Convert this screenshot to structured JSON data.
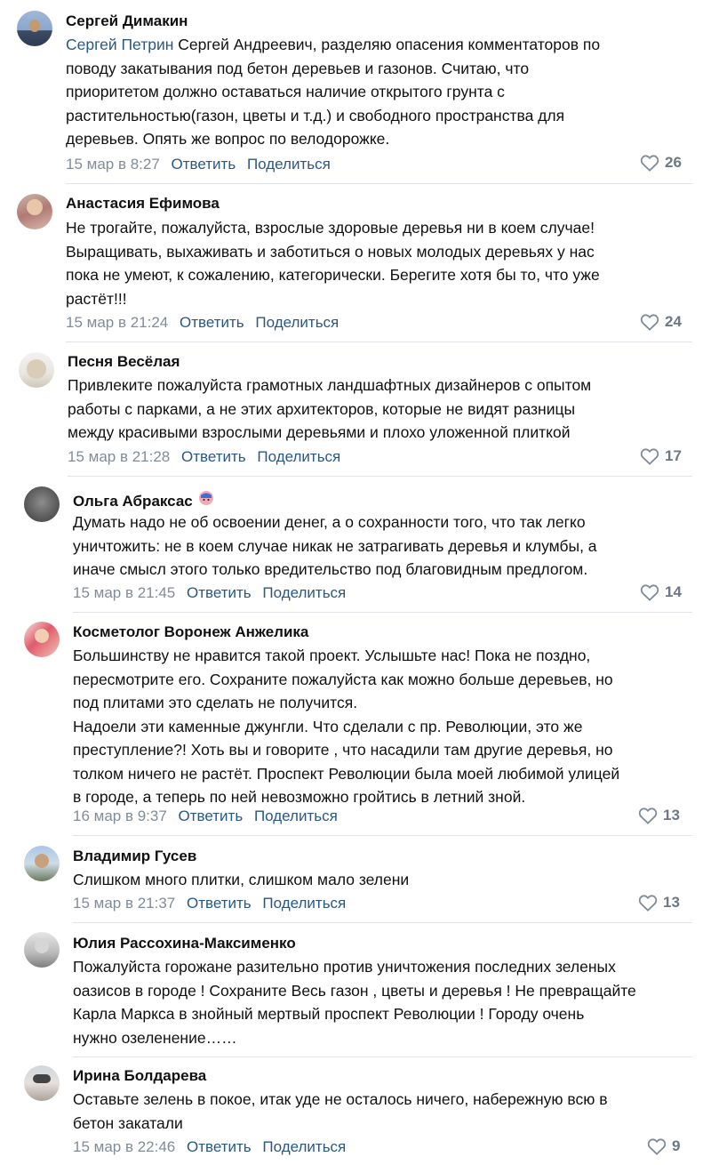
{
  "comments": [
    {
      "author": "Сергей Димакин",
      "mention": "Сергей Петрин",
      "lines": [
        " Сергей Андреевич, разделяю опасения комментаторов по",
        "поводу закатывания под бетон деревьев и газонов. Считаю, что",
        "приоритетом должно оставаться наличие открытого грунта с",
        "растительностью(газон, цветы и т.д.) и свободного пространства для",
        "деревьев. Опять же вопрос по велодорожке."
      ],
      "time": "15 мар в 8:27",
      "reply": "Ответить",
      "share": "Поделиться",
      "likes": "26"
    },
    {
      "author": "Анастасия Ефимова",
      "lines": [
        "Не трогайте, пожалуйста, взрослые здоровые деревья ни в коем случае!",
        "Выращивать, выхаживать и заботиться о новых молодых деревьях у нас",
        "пока не умеют, к сожалению, категорически. Берегите хотя бы то, что уже",
        "растёт!!!"
      ],
      "time": "15 мар в 21:24",
      "reply": "Ответить",
      "share": "Поделиться",
      "likes": "24"
    },
    {
      "author": "Песня Весёлая",
      "lines": [
        "Привлеките пожалуйста грамотных ландшафтных дизайнеров с опытом",
        "работы с парками, а не этих архитекторов, которые не видят разницы",
        "между красивыми взрослыми деревьями и плохо уложенной плиткой"
      ],
      "time": "15 мар в 21:28",
      "reply": "Ответить",
      "share": "Поделиться",
      "likes": "17"
    },
    {
      "author": "Ольга Абраксас",
      "lines": [
        "Думать надо не об освоении денег, а о сохранности того, что так легко",
        "уничтожить: не в коем случае никак не затрагивать деревья и клумбы, а",
        "иначе смысл этого только вредительство под благовидным предлогом."
      ],
      "time": "15 мар в 21:45",
      "reply": "Ответить",
      "share": "Поделиться",
      "likes": "14"
    },
    {
      "author": "Косметолог Воронеж Анжелика",
      "lines": [
        "Большинству не нравится такой проект. Услышьте нас! Пока не поздно,",
        "пересмотрите его. Сохраните пожалуйста как можно больше деревьев, но",
        "под плитами это сделать не получится.",
        "Надоели эти каменные джунгли. Что сделали с пр. Революции, это же",
        "преступление?! Хоть вы и говорите , что насадили там другие деревья, но",
        "толком ничего не растёт. Проспект Революции была моей любимой улицей",
        "в городе, а теперь по ней невозможно гройтись в летний зной."
      ],
      "time": "16 мар в 9:37",
      "reply": "Ответить",
      "share": "Поделиться",
      "likes": "13"
    },
    {
      "author": "Владимир Гусев",
      "lines": [
        "Слишком много плитки, слишком мало зелени"
      ],
      "time": "15 мар в 21:37",
      "reply": "Ответить",
      "share": "Поделиться",
      "likes": "13"
    },
    {
      "author": "Юлия Рассохина-Максименко",
      "lines": [
        "Пожалуйста горожане разительно против уничтожения последних зеленых",
        "оазисов в городе ! Сохраните Весь газон , цветы и деревья ! Не превращайте",
        "Карла Маркса в знойный мертвый проспект Революции ! Городу очень",
        "нужно озеленение……"
      ]
    },
    {
      "author": "Ирина Болдарева",
      "lines": [
        "Оставьте зелень в покое, итак уде не осталось ничего, набережную всю в",
        "бетон закатали"
      ],
      "time": "15 мар в 22:46",
      "reply": "Ответить",
      "share": "Поделиться",
      "likes": "9"
    }
  ],
  "colors": {
    "link": "#2a5885",
    "meta": "#818c99",
    "likes": "#6d7885",
    "divider": "#dfe3e8"
  }
}
